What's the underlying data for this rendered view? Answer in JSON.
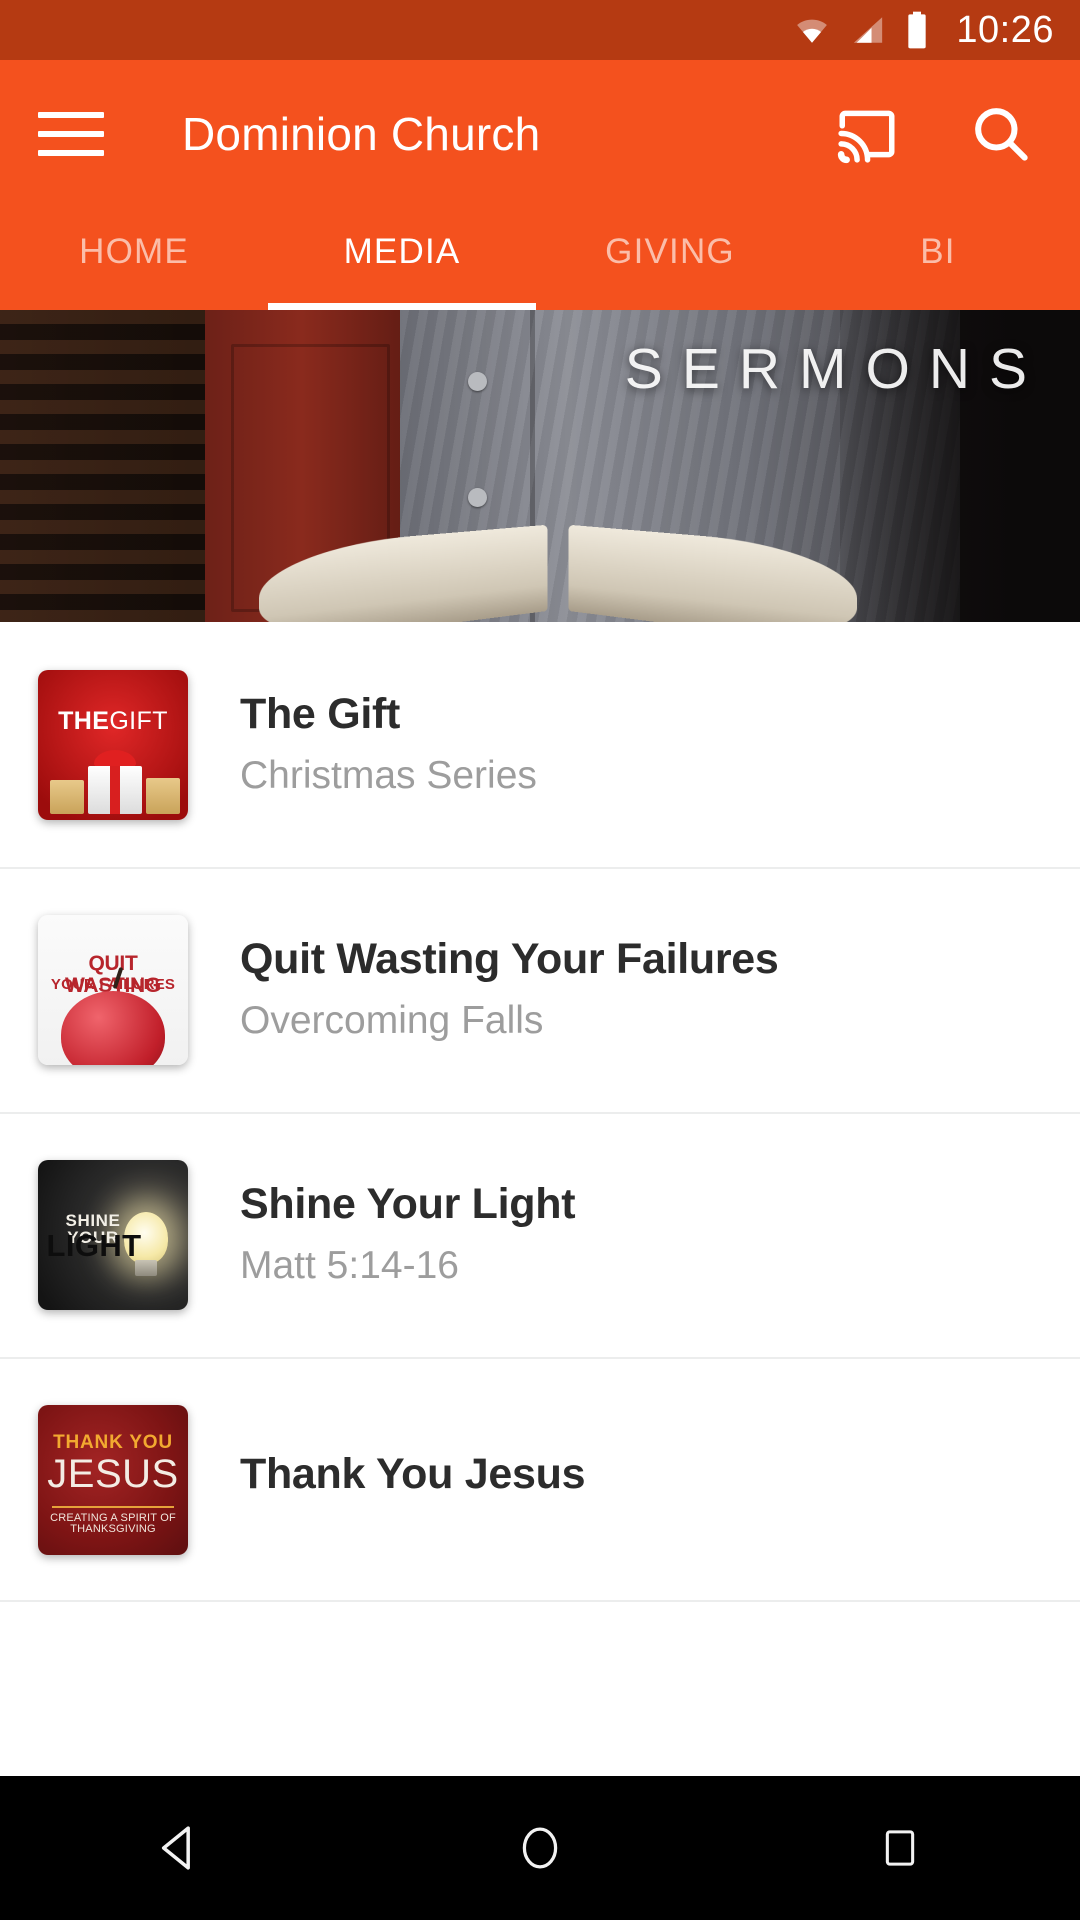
{
  "status_bar": {
    "time": "10:26",
    "icons": [
      "wifi-icon",
      "cellular-signal-icon",
      "battery-icon"
    ],
    "background_color": "#b53a12"
  },
  "app_bar": {
    "title": "Dominion Church",
    "menu_icon": "hamburger-menu-icon",
    "cast_icon": "cast-icon",
    "search_icon": "search-icon",
    "background_color": "#f4511e"
  },
  "tabs": {
    "active": "MEDIA",
    "items": [
      {
        "label": "HOME"
      },
      {
        "label": "MEDIA"
      },
      {
        "label": "GIVING"
      },
      {
        "label": "BI"
      }
    ]
  },
  "hero": {
    "title": "SERMONS",
    "description": "Man in chambray shirt holding an open book"
  },
  "media_list": [
    {
      "title": "The Gift",
      "subtitle": "Christmas Series",
      "thumbnail": {
        "name": "the-gift-thumbnail",
        "line1": "THE",
        "line2": "GIFT"
      }
    },
    {
      "title": "Quit Wasting Your Failures",
      "subtitle": "Overcoming Falls",
      "thumbnail": {
        "name": "quit-wasting-your-failures-thumbnail",
        "line1": "QUIT WASTING",
        "line2": "YOUR FAILURES"
      }
    },
    {
      "title": "Shine Your Light",
      "subtitle": "Matt 5:14-16",
      "thumbnail": {
        "name": "shine-your-light-thumbnail",
        "line1": "SHINE YOUR",
        "line2": "LIGHT"
      }
    },
    {
      "title": "Thank You Jesus",
      "subtitle": "",
      "thumbnail": {
        "name": "thank-you-jesus-thumbnail",
        "line1": "THANK YOU",
        "line2": "JESUS",
        "line3": "CREATING A SPIRIT OF THANKSGIVING"
      }
    }
  ],
  "nav_bar": {
    "back_icon": "back-triangle-icon",
    "home_icon": "home-circle-icon",
    "recents_icon": "recents-square-icon"
  }
}
